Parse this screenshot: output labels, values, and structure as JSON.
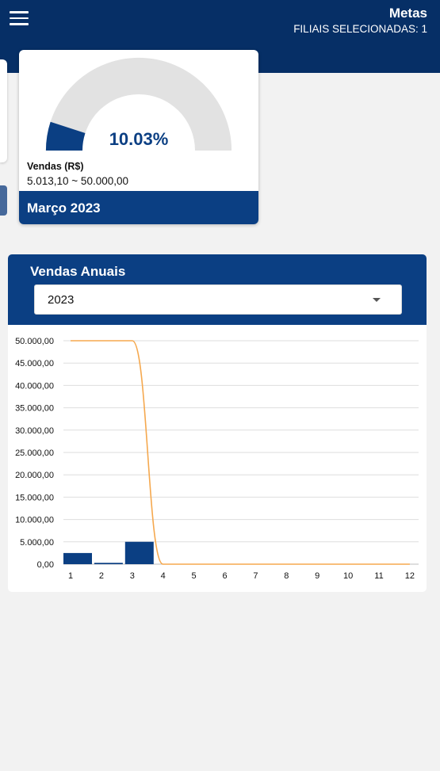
{
  "header": {
    "title": "Metas",
    "subtitle": "FILIAIS SELECIONADAS: 1"
  },
  "goal_card": {
    "percent_label": "10.03%",
    "percent_value": 10.03,
    "sales_label": "Vendas (R$)",
    "range_label": "5.013,10 ~ 50.000,00",
    "month_label": "Março 2023",
    "colors": {
      "fill": "#0b3f83",
      "track": "#e2e2e2"
    }
  },
  "annual": {
    "title": "Vendas Anuais",
    "year_selected": "2023"
  },
  "chart_data": {
    "type": "bar",
    "categories": [
      "1",
      "2",
      "3",
      "4",
      "5",
      "6",
      "7",
      "8",
      "9",
      "10",
      "11",
      "12"
    ],
    "y_tick_labels": [
      "0,00",
      "5.000,00",
      "10.000,00",
      "15.000,00",
      "20.000,00",
      "25.000,00",
      "30.000,00",
      "35.000,00",
      "40.000,00",
      "45.000,00",
      "50.000,00"
    ],
    "ylim": [
      0,
      50000
    ],
    "grid": true,
    "series": [
      {
        "kind": "bar",
        "color": "#0b3f83",
        "values": [
          2500,
          300,
          5013.1,
          0,
          0,
          0,
          0,
          0,
          0,
          0,
          0,
          0
        ]
      },
      {
        "kind": "line",
        "color": "#f5a84e",
        "values": [
          50000,
          50000,
          50000,
          0,
          0,
          0,
          0,
          0,
          0,
          0,
          0,
          0
        ]
      }
    ]
  }
}
